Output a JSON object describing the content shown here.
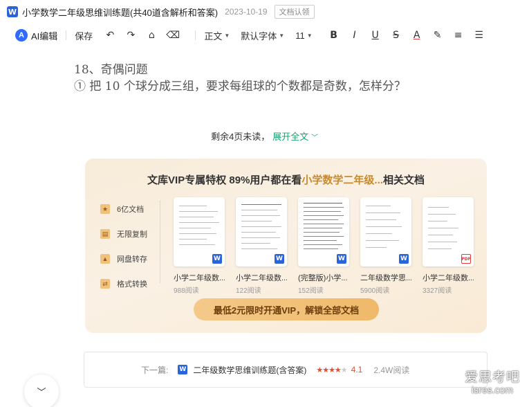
{
  "header": {
    "app_badge": "W",
    "title": "小学数学二年级思维训练题(共40道含解析和答案)",
    "date": "2023-10-19",
    "claim_tag": "文档认领"
  },
  "toolbar": {
    "ai_edit": "AI编辑",
    "save": "保存",
    "style": "正文",
    "font": "默认字体",
    "size": "11"
  },
  "content": {
    "question_title": "18、奇偶问题",
    "question_body": "① 把 10 个球分成三组，要求每组球的个数都是奇数，怎样分？"
  },
  "remaining": {
    "text": "剩余4页未读，",
    "expand": "展开全文"
  },
  "vip": {
    "headline_prefix": "文库VIP专属特权 89%用户都在看",
    "headline_highlight": "小学数学二年级...",
    "headline_suffix": "相关文档",
    "perks": [
      "6亿文档",
      "无限复制",
      "网盘转存",
      "格式转换"
    ],
    "docs": [
      {
        "name": "小学二年级数...",
        "reads": "988阅读",
        "format": "W"
      },
      {
        "name": "小学二年级数...",
        "reads": "122阅读",
        "format": "W"
      },
      {
        "name": "(完整版)小学...",
        "reads": "152阅读",
        "format": "W"
      },
      {
        "name": "二年级数学思...",
        "reads": "5900阅读",
        "format": "W"
      },
      {
        "name": "小学二年级数...",
        "reads": "3327阅读",
        "format": "PDF"
      }
    ],
    "button": "最低2元限时开通VIP，解锁全部文档"
  },
  "next": {
    "label": "下一篇:",
    "badge": "W",
    "title": "二年级数学思维训练题(含答案)",
    "rating": 4.1,
    "score": "4.1",
    "reads": "2.4W阅读"
  },
  "watermark": {
    "line1": "爱思考吧",
    "line2": "isres.com"
  },
  "colors": {
    "accent_green": "#1aa370",
    "word_blue": "#2b63d9",
    "vip_gold": "#c88a2c",
    "star_red": "#e34d2e"
  }
}
